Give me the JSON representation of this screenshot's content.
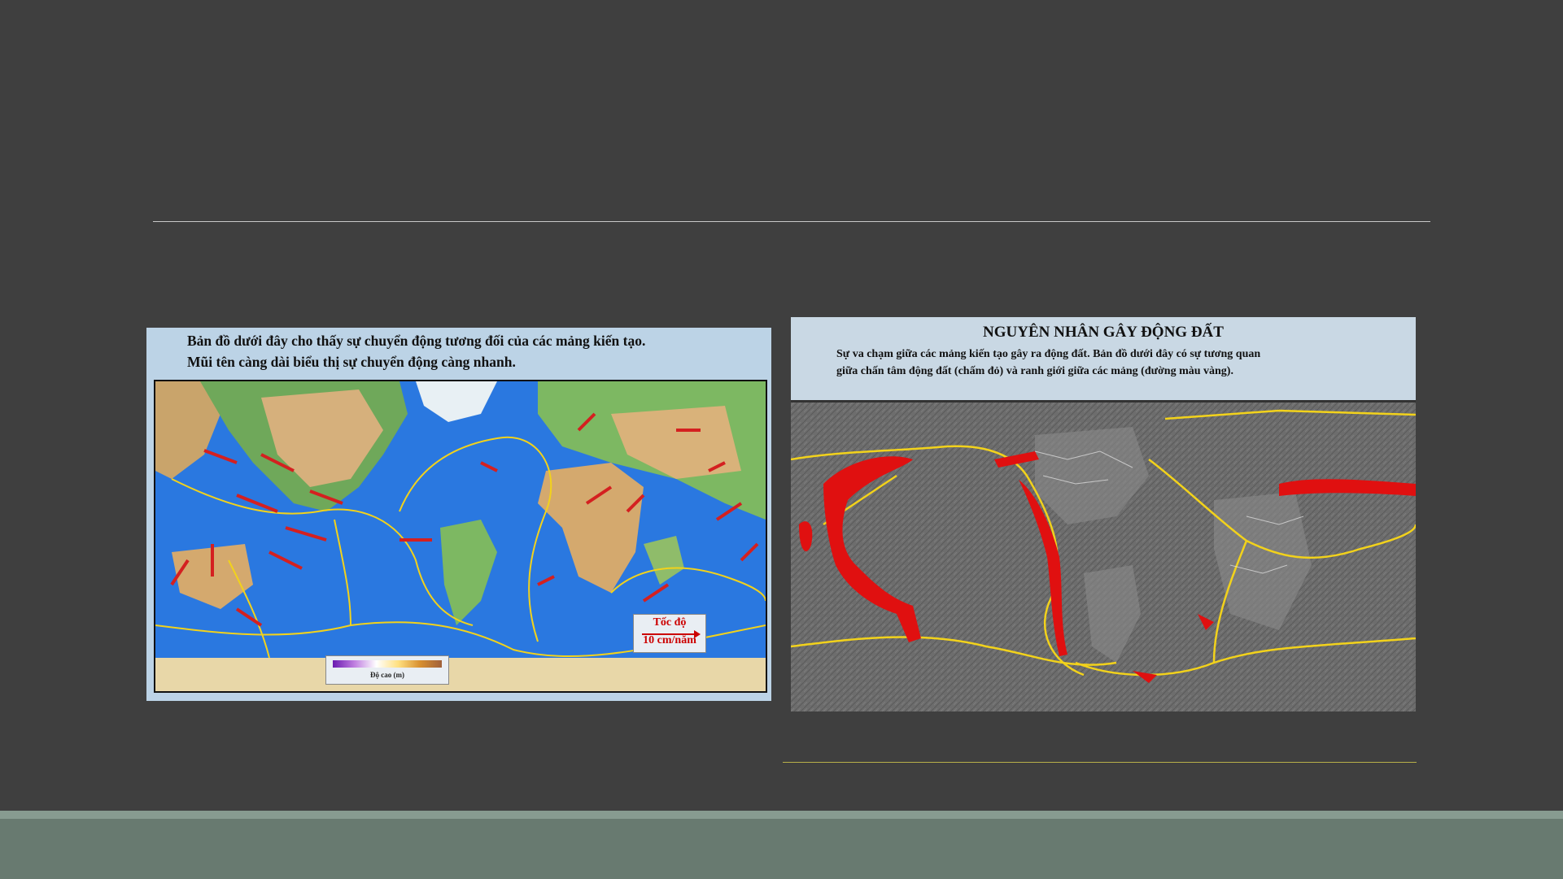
{
  "left_figure": {
    "caption_line1": "Bản đồ dưới đây cho thấy sự chuyển động tương đối của các mảng kiến tạo.",
    "caption_line2": "Mũi tên càng dài biểu thị sự chuyển động càng nhanh.",
    "speed_label": "Tốc độ",
    "speed_value": "10 cm/năm",
    "elevation_label": "Độ cao (m)"
  },
  "right_figure": {
    "title": "NGUYÊN NHÂN GÂY ĐỘNG ĐẤT",
    "caption_line1": "Sự va chạm giữa các mảng kiến tạo gây ra động đất. Bản đồ dưới đây có sự tương quan",
    "caption_line2": "giữa chấn tâm động đất (chấm đỏ) và ranh giới giữa các mảng (đường màu vàng)."
  },
  "colors": {
    "background": "#3f3f3f",
    "footer": "#687a70",
    "arrow": "#d42020",
    "plate_boundary": "#f2d21b",
    "epicenter": "#e01010"
  }
}
